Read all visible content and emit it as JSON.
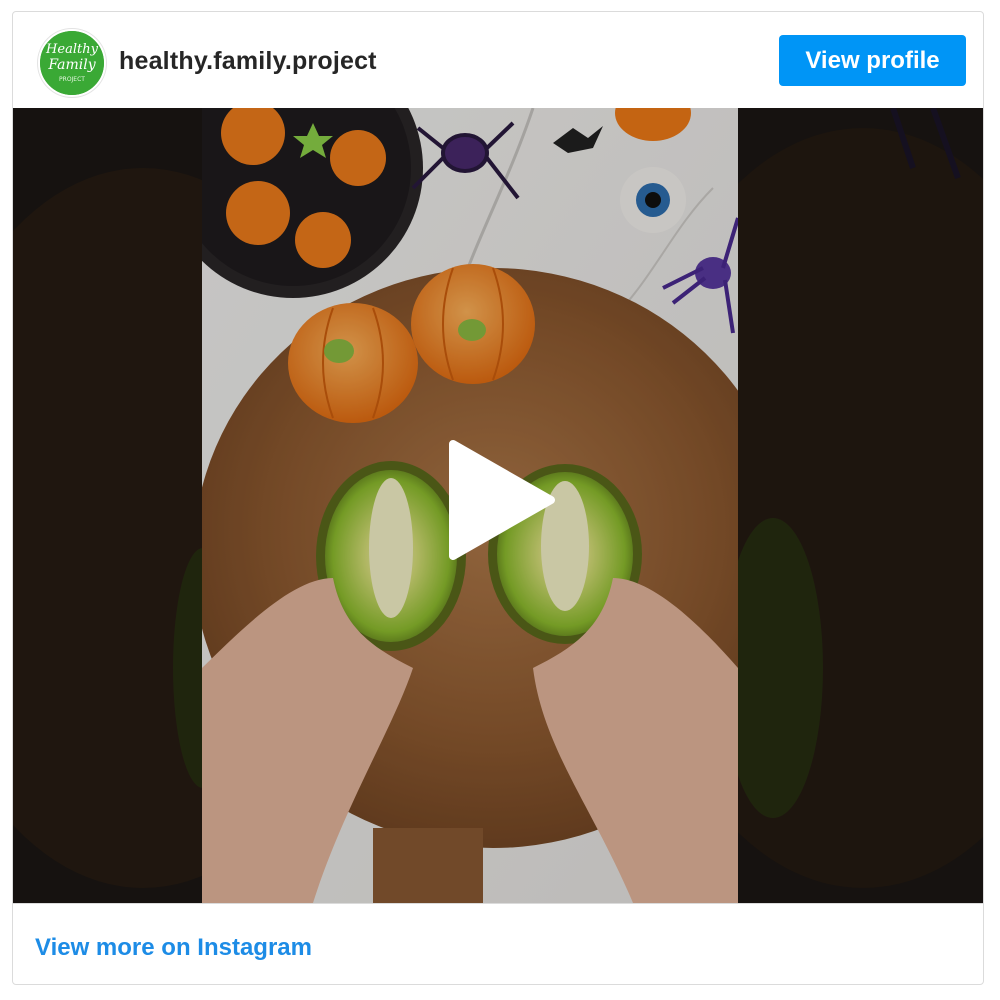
{
  "header": {
    "username": "healthy.family.project",
    "avatar_text_line1": "Healthy",
    "avatar_text_line2": "Family",
    "avatar_text_line3": "PROJECT",
    "view_profile_label": "View profile"
  },
  "media": {
    "type": "video",
    "play_icon": "play-icon",
    "content_icons": [
      "pumpkin-plate",
      "spider-icon",
      "eyeball-icon",
      "bat-icon",
      "kiwi-halves",
      "tangerine-pumpkins"
    ]
  },
  "footer": {
    "link_label": "View more on Instagram"
  },
  "colors": {
    "accent": "#0095f6",
    "link": "#1d8ce6",
    "username": "#262626",
    "border": "#dbdbdb",
    "avatar_bg": "#3aa935"
  }
}
